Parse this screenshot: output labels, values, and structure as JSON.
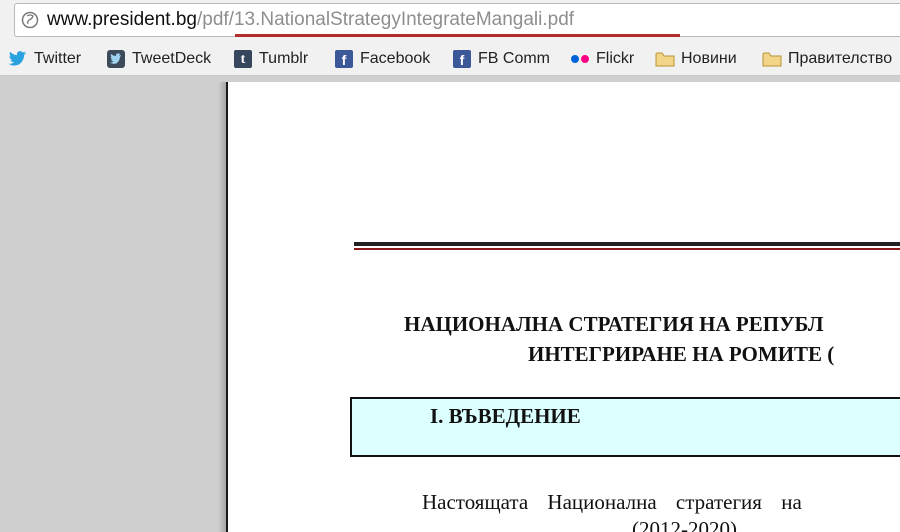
{
  "address_bar": {
    "url_host": "www.president.bg",
    "url_path": "/pdf/13.NationalStrategyIntegrateMangali.pdf",
    "underline_color": "#b22e2e"
  },
  "bookmarks": [
    {
      "label": "Twitter",
      "icon": "twitter-bird-icon"
    },
    {
      "label": "TweetDeck",
      "icon": "tweetdeck-icon"
    },
    {
      "label": "Tumblr",
      "icon": "tumblr-icon"
    },
    {
      "label": "Facebook",
      "icon": "facebook-icon"
    },
    {
      "label": "FB Comm",
      "icon": "facebook-icon"
    },
    {
      "label": "Flickr",
      "icon": "flickr-icon"
    },
    {
      "label": "Новини",
      "icon": "folder-icon"
    },
    {
      "label": "Правителство",
      "icon": "folder-icon"
    }
  ],
  "document": {
    "title_line_1": "НАЦИОНАЛНА СТРАТЕГИЯ НА РЕПУБЛ",
    "title_line_2": "ИНТЕГРИРАНЕ НА РОМИТЕ  (",
    "section_heading": "I. ВЪВЕДЕНИЕ",
    "body_line_1": "Настоящата Национална стратегия на",
    "body_line_2": "(2012-2020)",
    "section_box_color": "#dcffff",
    "rule_color": "#8b1a1a"
  }
}
